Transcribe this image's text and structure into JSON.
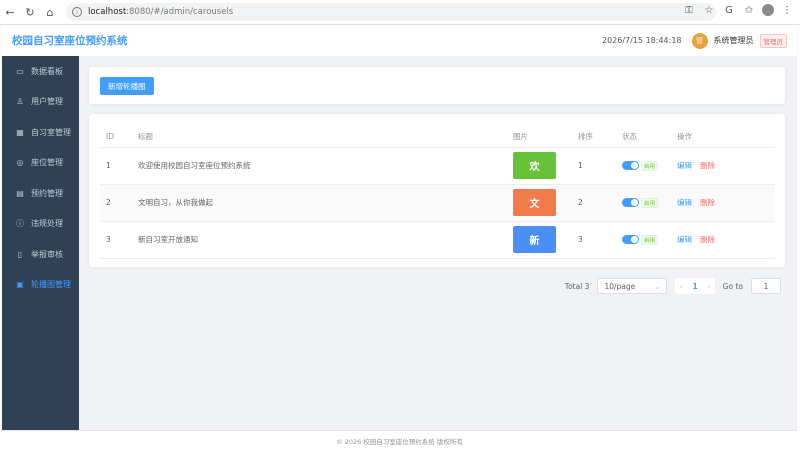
{
  "browser": {
    "url_host": "localhost",
    "url_path": ":8080/#/admin/carousels"
  },
  "header": {
    "app_title": "校园自习室座位预约系统",
    "datetime": "2026/7/15 18:44:18",
    "avatar_text": "管",
    "username": "系统管理员",
    "role": "管理员"
  },
  "sidebar": {
    "items": [
      {
        "label": "数据看板",
        "icon": "monitor-icon",
        "glyph": "▭"
      },
      {
        "label": "用户管理",
        "icon": "user-icon",
        "glyph": "♙"
      },
      {
        "label": "自习室管理",
        "icon": "building-icon",
        "glyph": "▦"
      },
      {
        "label": "座位管理",
        "icon": "location-icon",
        "glyph": "◎"
      },
      {
        "label": "预约管理",
        "icon": "calendar-icon",
        "glyph": "▤"
      },
      {
        "label": "违规处理",
        "icon": "warning-icon",
        "glyph": "ⓘ"
      },
      {
        "label": "举报审核",
        "icon": "document-icon",
        "glyph": "▯"
      },
      {
        "label": "轮播图管理",
        "icon": "picture-icon",
        "glyph": "▣"
      }
    ],
    "active_index": 7
  },
  "toolbar": {
    "add_label": "新增轮播图"
  },
  "table": {
    "headers": [
      "ID",
      "标题",
      "图片",
      "排序",
      "状态",
      "操作"
    ],
    "rows": [
      {
        "id": "1",
        "title": "欢迎使用校园自习室座位预约系统",
        "thumb_char": "欢",
        "thumb_color": "#67c23a",
        "order": "1",
        "status": "启用",
        "edit": "编辑",
        "delete": "删除"
      },
      {
        "id": "2",
        "title": "文明自习，从你我做起",
        "thumb_char": "文",
        "thumb_color": "#f07a4a",
        "order": "2",
        "status": "启用",
        "edit": "编辑",
        "delete": "删除"
      },
      {
        "id": "3",
        "title": "新自习室开放通知",
        "thumb_char": "新",
        "thumb_color": "#4b8ef5",
        "order": "3",
        "status": "启用",
        "edit": "编辑",
        "delete": "删除"
      }
    ]
  },
  "pagination": {
    "total": "Total 3",
    "page_size": "10/page",
    "current_page": "1",
    "goto_label": "Go to",
    "goto_value": "1"
  },
  "footer": {
    "text": "© 2026 校园自习室座位预约系统 版权所有"
  }
}
